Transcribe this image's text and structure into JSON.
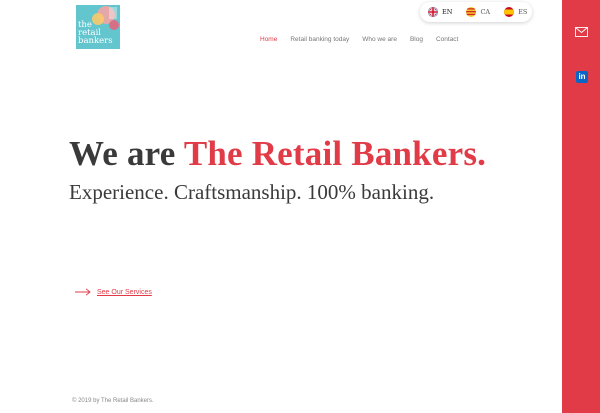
{
  "logo": {
    "lines": [
      "the",
      "retail",
      "bankers"
    ]
  },
  "languages": [
    {
      "code": "EN",
      "flag": "uk-flag-icon",
      "active": true
    },
    {
      "code": "CA",
      "flag": "catalan-flag-icon",
      "active": false
    },
    {
      "code": "ES",
      "flag": "spain-flag-icon",
      "active": false
    }
  ],
  "nav": {
    "items": [
      "Home",
      "Retail banking today",
      "Who we are",
      "Blog",
      "Contact"
    ],
    "active": "Home"
  },
  "hero": {
    "title_prefix": "We are ",
    "title_accent": "The Retail Bankers.",
    "subtitle": "Experience. Craftsmanship. 100% banking."
  },
  "cta": {
    "label": "See Our Services",
    "icon": "arrow-right-icon"
  },
  "footer": {
    "text": "© 2019 by The Retail Bankers."
  },
  "rail": {
    "icons": [
      "mail-icon",
      "linkedin-icon"
    ],
    "linkedin_label": "in"
  },
  "colors": {
    "accent": "#e13b48",
    "text": "#3a3a3a",
    "logo_bg": "#5fc3cc",
    "linkedin": "#0a66c2"
  }
}
